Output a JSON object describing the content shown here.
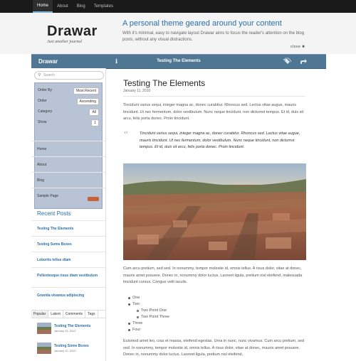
{
  "topnav": {
    "items": [
      {
        "label": "Home",
        "active": true
      },
      {
        "label": "About",
        "active": false
      },
      {
        "label": "Blog",
        "active": false
      },
      {
        "label": "Templates",
        "active": false
      }
    ]
  },
  "header": {
    "site_title": "Drawar",
    "tagline": "Just another journal",
    "intro_title": "A personal theme geared around your content",
    "intro_text": "With it's minimal, easy to navigate layout Drawar aims to focus the reader's attention on the blog posts, without any visual distractions.",
    "close_label": "close ✖"
  },
  "navbar": {
    "brand": "Drawar",
    "info_icon": "i",
    "post_title": "Testing The Elements"
  },
  "sidebar": {
    "search_placeholder": "Search",
    "filter": {
      "order_by_label": "Order By",
      "order_by_value": "Most Recent",
      "order_label": "Order",
      "order_value": "Ascending",
      "category_label": "Category",
      "category_value": "All",
      "show_label": "Show",
      "show_value": "1"
    },
    "menu": [
      "Home",
      "About",
      "Blog",
      "Sample Page"
    ],
    "recent_heading": "Recent Posts",
    "recent": [
      "Testing The Elements",
      "Testing Some Boxes",
      "Lobortis tellus diam",
      "Pellentesque risus diam vestibulum",
      "Gravida vivamus adipiscing"
    ],
    "tabs": [
      "Popular",
      "Latest",
      "Comments",
      "Tags"
    ],
    "popular": [
      {
        "title": "Testing The Elements",
        "date": "January 11, 2010"
      },
      {
        "title": "Testing Some Boxes",
        "date": "January 11, 2010"
      }
    ]
  },
  "post": {
    "title": "Testing The Elements",
    "date": "January 11, 2010",
    "para1": "Tincidunt varius sequi, integer magna ac, donec curabitur. Rhoncus sed. Lectus vitae augue, mauris tincidunt. Ut nec fermentum, dolor vestibulum. Nunc neque tincidunt, non dictumst tempus. Et id, duis sit arcu, felis porta donec. Proin tincidunt.",
    "quote": "Tincidunt varius sequi, integer magna ac, donec curabitur. Rhoncus sed. Lectus vitae augue, mauris tincidunt. Ut nec fermentum, dolor vestibulum. Nunc neque tincidunt, non dictumst tempus. Et id, duis sit arcu, felis porta donec. Proin tincidunt.",
    "para2": "Cum arcu pretium, sed sed. In nonummy, tempor molestie id, omnis tellus. A risus dolor, vitae at donec, mauris amet posuere. Donec in, nonummy dolor luctus. Laoreet ligula, pretium nisl eleifend, malesuada tincidunt cursus. Congue velit iaculis.",
    "list": [
      {
        "text": "One",
        "level": 1
      },
      {
        "text": "Two",
        "level": 1
      },
      {
        "text": "Two Point One",
        "level": 2
      },
      {
        "text": "Two Point Three",
        "level": 2
      },
      {
        "text": "Three",
        "level": 1
      },
      {
        "text": "Four",
        "level": 1
      }
    ],
    "para3": "Euismod amet leo, cras et massa, eleifend egestas. Urna in nunc, nunc vivamus. Cum arcu pretium, sed sed. In nonummy, tempor molestie id, omnis tellus. A risus dolor, vitae at donec, mauris amet posuere. Donec in, nonummy dolor luctus. Laoreet ligula, pretium nisl eleifend,"
  },
  "colors": {
    "accent": "#2a6ea8",
    "navbar": "#4f7693",
    "topbar": "#1a1a1a",
    "filter_panel": "#b8c4d6",
    "apply_button": "#c8603a"
  }
}
